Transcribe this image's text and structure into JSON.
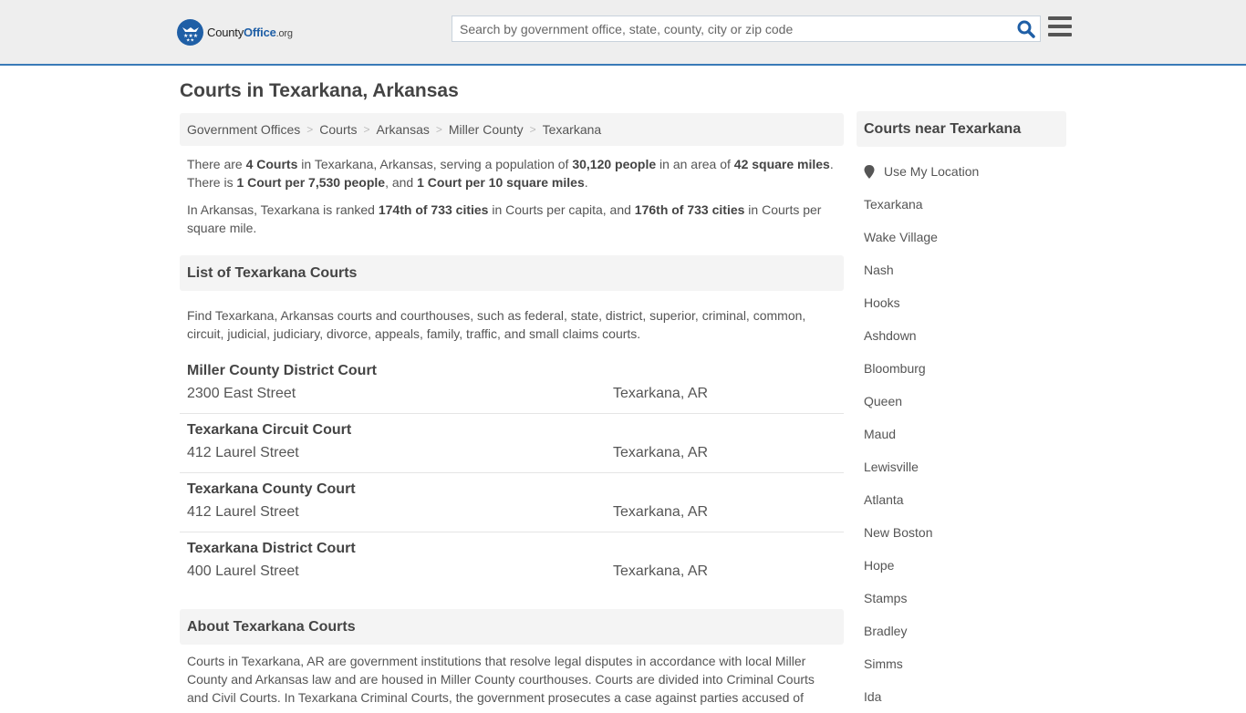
{
  "header": {
    "logo": {
      "brand_a": "County",
      "brand_b": "Office",
      "brand_c": ".org"
    },
    "search": {
      "placeholder": "Search by government office, state, county, city or zip code",
      "value": ""
    },
    "colors": {
      "accent": "#1f5fa6",
      "bar_border": "#3a7ab8",
      "bar_bg": "#eeeeee"
    }
  },
  "page": {
    "title": "Courts in Texarkana, Arkansas"
  },
  "breadcrumb": [
    {
      "label": "Government Offices"
    },
    {
      "label": "Courts"
    },
    {
      "label": "Arkansas"
    },
    {
      "label": "Miller County"
    },
    {
      "label": "Texarkana"
    }
  ],
  "summary": {
    "p1": {
      "t1": "There are ",
      "b1": "4 Courts",
      "t2": " in Texarkana, Arkansas, serving a population of ",
      "b2": "30,120 people",
      "t3": " in an area of ",
      "b3": "42 square miles",
      "t4": ". There is ",
      "b4": "1 Court per 7,530 people",
      "t5": ", and ",
      "b5": "1 Court per 10 square miles",
      "t6": "."
    },
    "p2": {
      "t1": "In Arkansas, Texarkana is ranked ",
      "b1": "174th of 733 cities",
      "t2": " in Courts per capita, and ",
      "b2": "176th of 733 cities",
      "t3": " in Courts per square mile."
    }
  },
  "list": {
    "heading": "List of Texarkana Courts",
    "intro": "Find Texarkana, Arkansas courts and courthouses, such as federal, state, district, superior, criminal, common, circuit, judicial, judiciary, divorce, appeals, family, traffic, and small claims courts.",
    "courts": [
      {
        "name": "Miller County District Court",
        "address": "2300 East Street",
        "city": "Texarkana, AR"
      },
      {
        "name": "Texarkana Circuit Court",
        "address": "412 Laurel Street",
        "city": "Texarkana, AR"
      },
      {
        "name": "Texarkana County Court",
        "address": "412 Laurel Street",
        "city": "Texarkana, AR"
      },
      {
        "name": "Texarkana District Court",
        "address": "400 Laurel Street",
        "city": "Texarkana, AR"
      }
    ]
  },
  "about": {
    "heading": "About Texarkana Courts",
    "text": "Courts in Texarkana, AR are government institutions that resolve legal disputes in accordance with local Miller County and Arkansas law and are housed in Miller County courthouses. Courts are divided into Criminal Courts and Civil Courts. In Texarkana Criminal Courts, the government prosecutes a case against parties accused of"
  },
  "sidebar": {
    "heading": "Courts near Texarkana",
    "use_location": "Use My Location",
    "cities": [
      "Texarkana",
      "Wake Village",
      "Nash",
      "Hooks",
      "Ashdown",
      "Bloomburg",
      "Queen",
      "Maud",
      "Lewisville",
      "Atlanta",
      "New Boston",
      "Hope",
      "Stamps",
      "Bradley",
      "Simms",
      "Ida"
    ]
  }
}
